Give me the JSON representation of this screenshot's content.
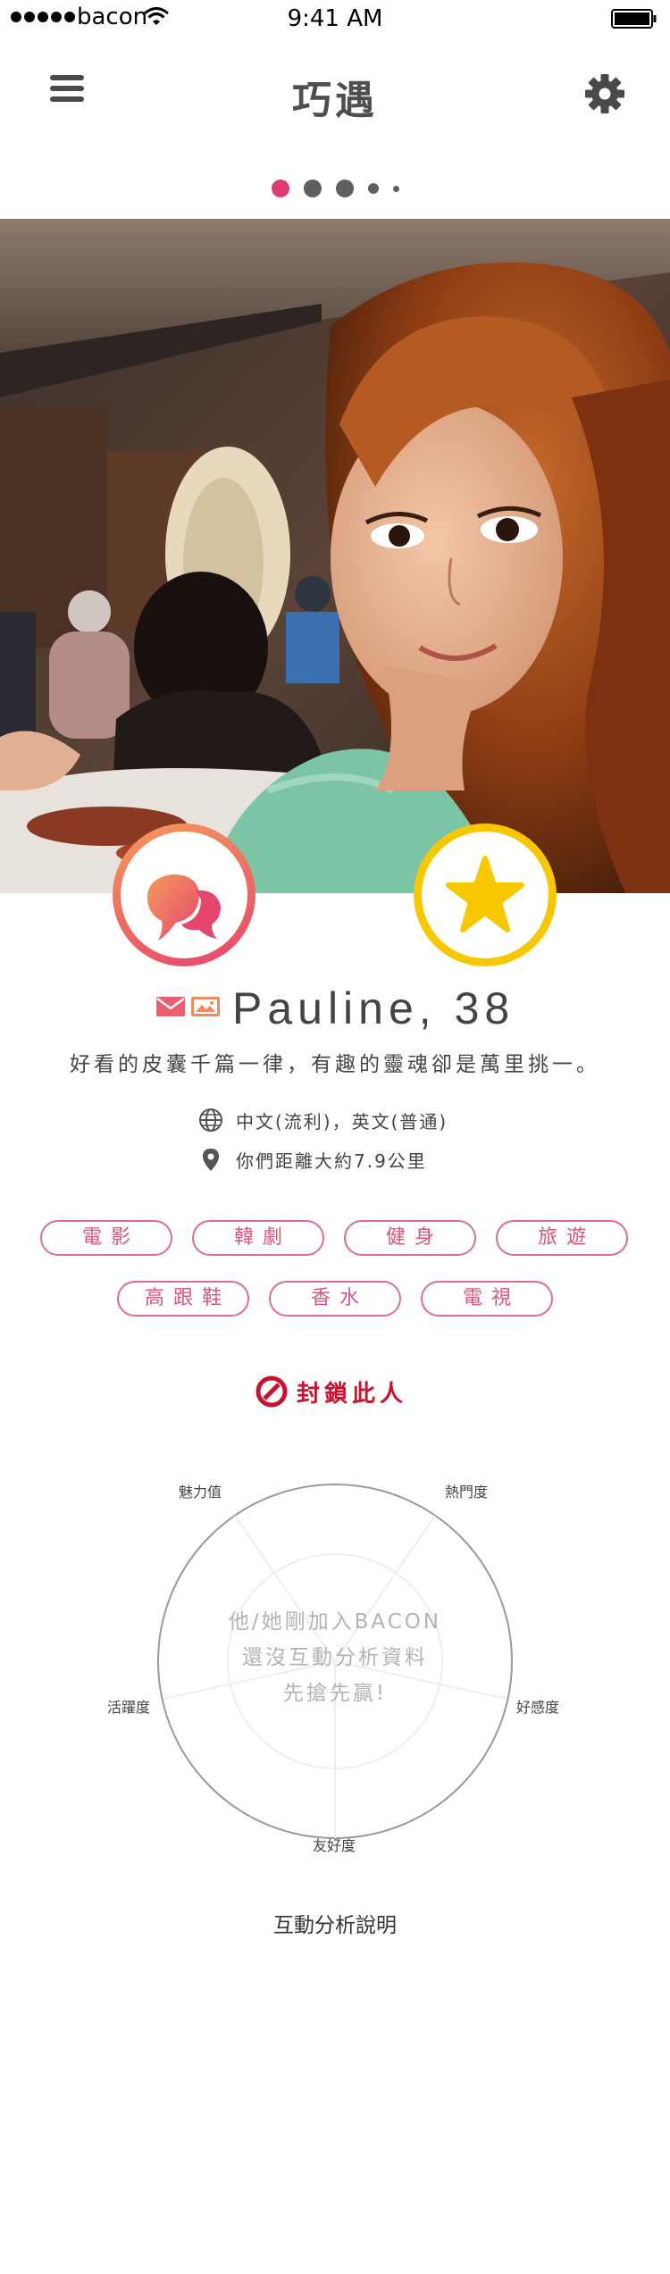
{
  "status_bar": {
    "carrier": "bacon",
    "time": "9:41 AM"
  },
  "header": {
    "title": "巧遇"
  },
  "pager": {
    "pages": 5,
    "active": 1
  },
  "profile": {
    "name": "Pauline, 38",
    "bio": "好看的皮囊千篇一律，有趣的靈魂卻是萬里挑一。",
    "languages": "中文(流利)，英文(普通)",
    "distance": "你們距離大約7.9公里"
  },
  "tags": [
    "電影",
    "韓劇",
    "健身",
    "旅遊",
    "高跟鞋",
    "香水",
    "電視"
  ],
  "block": {
    "label": "封鎖此人"
  },
  "radar": {
    "labels": {
      "top_left": "魅力值",
      "top_right": "熱門度",
      "left": "活躍度",
      "right": "好感度",
      "bottom": "友好度"
    },
    "message_lines": [
      "他/她剛加入BACON",
      "還沒互動分析資料",
      "先搶先贏!"
    ]
  },
  "analysis_link": "互動分析說明",
  "colors": {
    "accent_pink": "#e6456d",
    "accent_orange": "#f49a5c",
    "star_yellow": "#f7c700",
    "block_red": "#c6132f",
    "tag_pink": "#dd6f8d"
  }
}
